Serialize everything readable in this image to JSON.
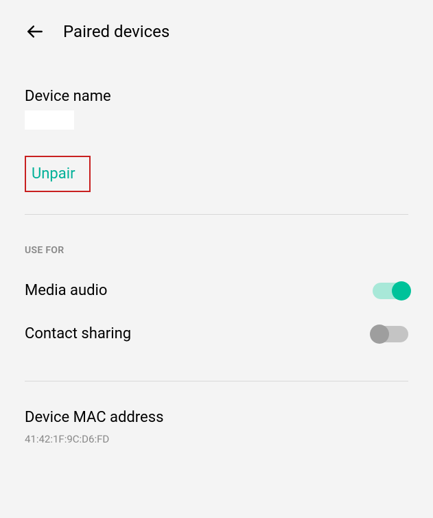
{
  "header": {
    "title": "Paired devices"
  },
  "device": {
    "label": "Device name",
    "value": ""
  },
  "unpair": {
    "label": "Unpair"
  },
  "useFor": {
    "sectionLabel": "USE FOR",
    "mediaAudio": {
      "label": "Media audio",
      "enabled": true
    },
    "contactSharing": {
      "label": "Contact sharing",
      "enabled": false
    }
  },
  "mac": {
    "label": "Device MAC address",
    "value": "41:42:1F:9C:D6:FD"
  }
}
